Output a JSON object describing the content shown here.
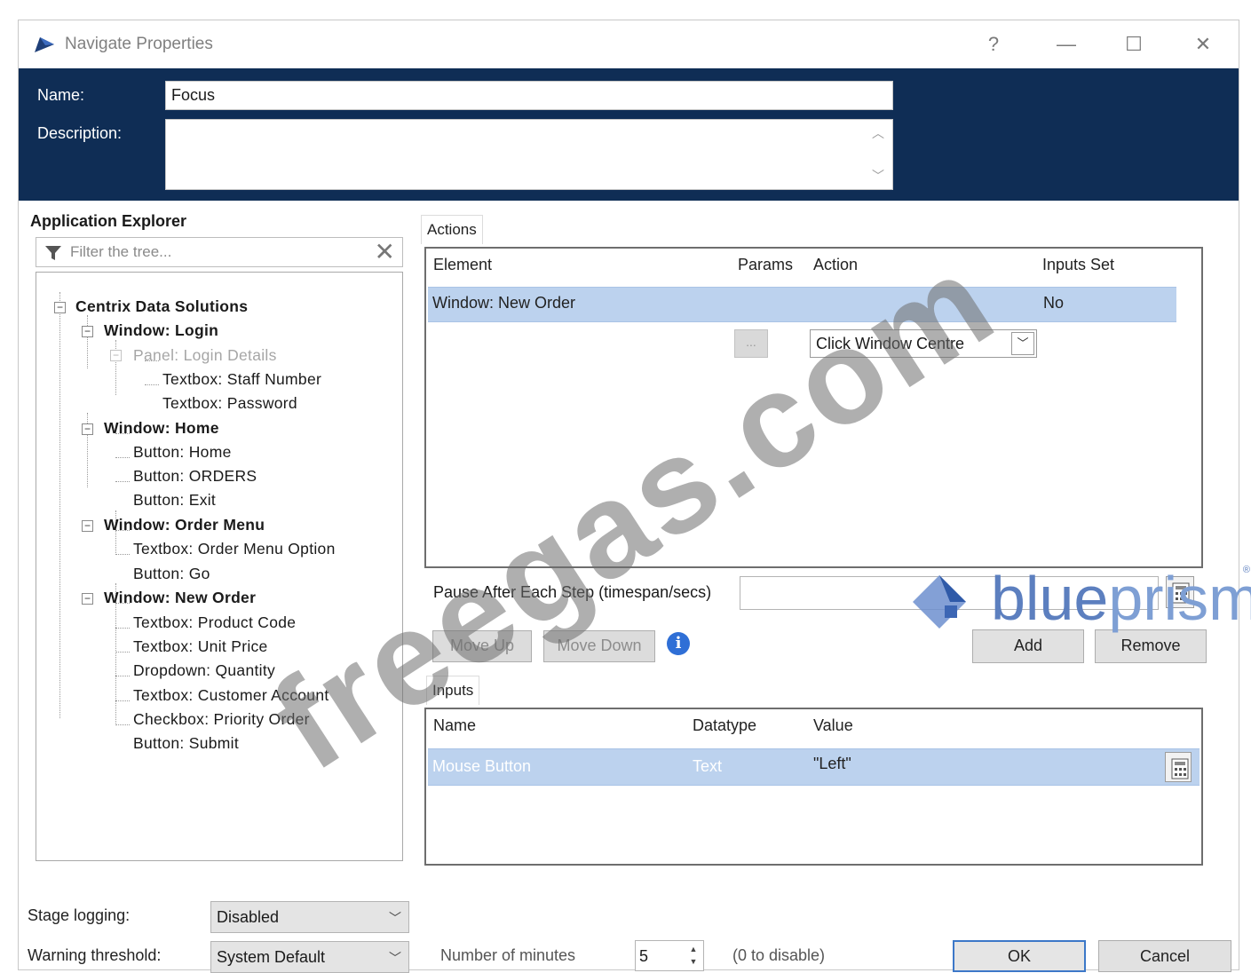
{
  "window": {
    "title": "Navigate Properties",
    "controls": {
      "help": "?",
      "minimize": "—",
      "maximize": "☐",
      "close": "✕"
    }
  },
  "header": {
    "name_label": "Name:",
    "name_value": "Focus",
    "description_label": "Description:",
    "description_value": ""
  },
  "app_explorer": {
    "title": "Application Explorer",
    "filter_placeholder": "Filter the tree...",
    "tree": [
      {
        "label": "Centrix Data Solutions",
        "level": 0,
        "bold": true,
        "expander": "−"
      },
      {
        "label": "Window: Login",
        "level": 1,
        "bold": true,
        "expander": "−"
      },
      {
        "label": "Panel: Login Details",
        "level": 2,
        "grey": true,
        "expander": "−"
      },
      {
        "label": "Textbox: Staff Number",
        "level": 3
      },
      {
        "label": "Textbox: Password",
        "level": 3
      },
      {
        "label": "Window: Home",
        "level": 1,
        "bold": true,
        "expander": "−"
      },
      {
        "label": "Button: Home",
        "level": 2
      },
      {
        "label": "Button: ORDERS",
        "level": 2
      },
      {
        "label": "Button: Exit",
        "level": 2
      },
      {
        "label": "Window: Order Menu",
        "level": 1,
        "bold": true,
        "expander": "−"
      },
      {
        "label": "Textbox: Order Menu Option",
        "level": 2
      },
      {
        "label": "Button: Go",
        "level": 2
      },
      {
        "label": "Window: New Order",
        "level": 1,
        "bold": true,
        "expander": "−"
      },
      {
        "label": "Textbox: Product Code",
        "level": 2
      },
      {
        "label": "Textbox: Unit Price",
        "level": 2
      },
      {
        "label": "Dropdown: Quantity",
        "level": 2
      },
      {
        "label": "Textbox: Customer Account",
        "level": 2
      },
      {
        "label": "Checkbox: Priority Order",
        "level": 2
      },
      {
        "label": "Button: Submit",
        "level": 2
      }
    ]
  },
  "actions": {
    "tab_label": "Actions",
    "columns": {
      "element": "Element",
      "params": "Params",
      "action": "Action",
      "inputs_set": "Inputs Set"
    },
    "rows": [
      {
        "element": "Window: New Order",
        "params": "...",
        "action": "Click Window Centre",
        "inputs_set": "No"
      }
    ],
    "pause_label": "Pause After Each Step (timespan/secs)",
    "pause_value": "",
    "move_up": "Move Up",
    "move_down": "Move Down",
    "info_icon": "i",
    "add": "Add",
    "remove": "Remove"
  },
  "inputs": {
    "tab_label": "Inputs",
    "columns": {
      "name": "Name",
      "datatype": "Datatype",
      "value": "Value"
    },
    "rows": [
      {
        "name": "Mouse Button",
        "datatype": "Text",
        "value": "\"Left\""
      }
    ]
  },
  "footer": {
    "stage_logging_label": "Stage logging:",
    "stage_logging_value": "Disabled",
    "warning_threshold_label": "Warning threshold:",
    "warning_threshold_value": "System Default",
    "minutes_label": "Number of minutes",
    "minutes_value": "5",
    "disable_hint": "(0 to disable)",
    "ok": "OK",
    "cancel": "Cancel"
  },
  "watermark": {
    "text": "freegas.com"
  },
  "logo": {
    "brand_part1": "blue",
    "brand_part2": "prism",
    "reg": "®"
  },
  "colors": {
    "header_bg": "#0f2d55",
    "selection": "#bcd2ee",
    "accent": "#2f6fd6"
  }
}
